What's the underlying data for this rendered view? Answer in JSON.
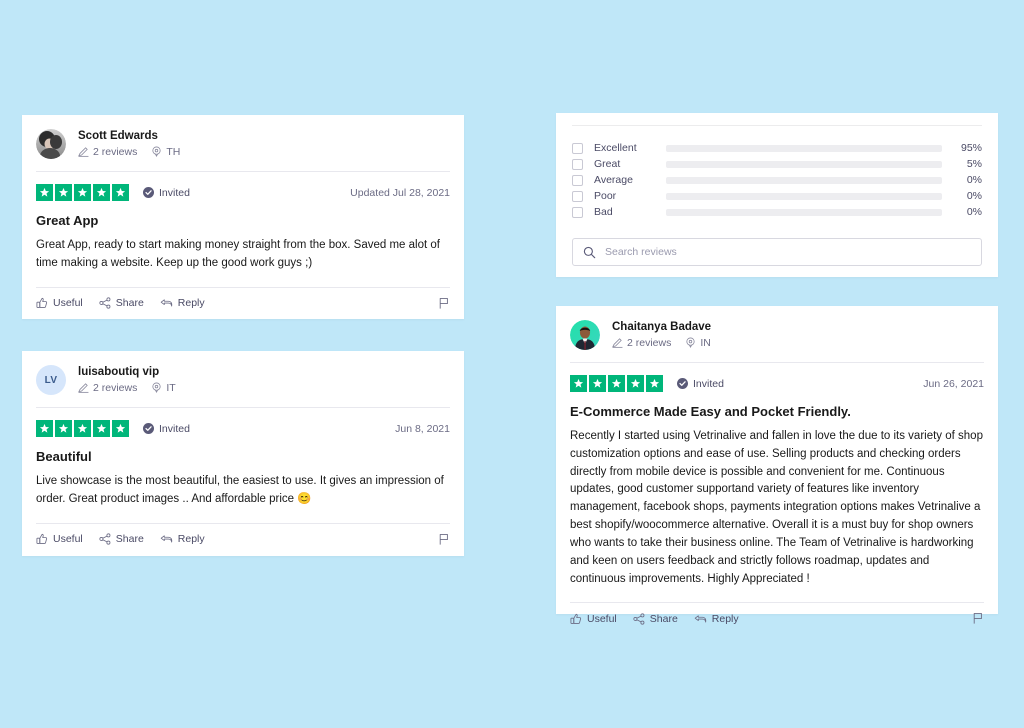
{
  "theme": {
    "background": "#bfe7f8",
    "card_background": "#ffffff",
    "star_green": "#00b67a",
    "bar_fill": "#585a74",
    "bar_track": "#ededf0",
    "text_primary": "#191919",
    "text_muted": "#6b6b84"
  },
  "reviews": [
    {
      "author": "Scott Edwards",
      "avatar_type": "photo",
      "avatar_initials": "",
      "reviews_count": "2 reviews",
      "country": "TH",
      "rating": 5,
      "verified_label": "Invited",
      "date": "Updated Jul 28, 2021",
      "title": "Great App",
      "body": "Great App, ready to start making money straight from the box. Saved me alot of time making a website. Keep up the good work guys ;)",
      "actions": {
        "useful": "Useful",
        "share": "Share",
        "reply": "Reply"
      }
    },
    {
      "author": "luisaboutiq vip",
      "avatar_type": "initials",
      "avatar_initials": "LV",
      "reviews_count": "2 reviews",
      "country": "IT",
      "rating": 5,
      "verified_label": "Invited",
      "date": "Jun 8, 2021",
      "title": "Beautiful",
      "body": "Live showcase is the most beautiful, the easiest to use. It gives an impression of order. Great product images .. And affordable price 😊",
      "actions": {
        "useful": "Useful",
        "share": "Share",
        "reply": "Reply"
      }
    },
    {
      "author": "Chaitanya Badave",
      "avatar_type": "photo-teal",
      "avatar_initials": "",
      "reviews_count": "2 reviews",
      "country": "IN",
      "rating": 5,
      "verified_label": "Invited",
      "date": "Jun 26, 2021",
      "title": "E-Commerce Made Easy and Pocket Friendly.",
      "body": "Recently I started using Vetrinalive and fallen in love the due to its variety of shop customization options and ease of use. Selling products and checking orders directly from mobile device is possible and convenient for me. Continuous updates, good customer supportand variety of features like inventory management, facebook shops, payments integration options makes Vetrinalive a best shopify/woocommerce alternative. Overall it is a must buy for shop owners who wants to take their business online. The Team of Vetrinalive is hardworking and keen on users feedback and strictly follows roadmap, updates and continuous improvements. Highly Appreciated !",
      "actions": {
        "useful": "Useful",
        "share": "Share",
        "reply": "Reply"
      }
    }
  ],
  "distribution": {
    "rows": [
      {
        "label": "Excellent",
        "percent": "95%",
        "value": 95
      },
      {
        "label": "Great",
        "percent": "5%",
        "value": 5
      },
      {
        "label": "Average",
        "percent": "0%",
        "value": 0
      },
      {
        "label": "Poor",
        "percent": "0%",
        "value": 0
      },
      {
        "label": "Bad",
        "percent": "0%",
        "value": 0
      }
    ]
  },
  "search": {
    "placeholder": "Search reviews",
    "value": ""
  }
}
